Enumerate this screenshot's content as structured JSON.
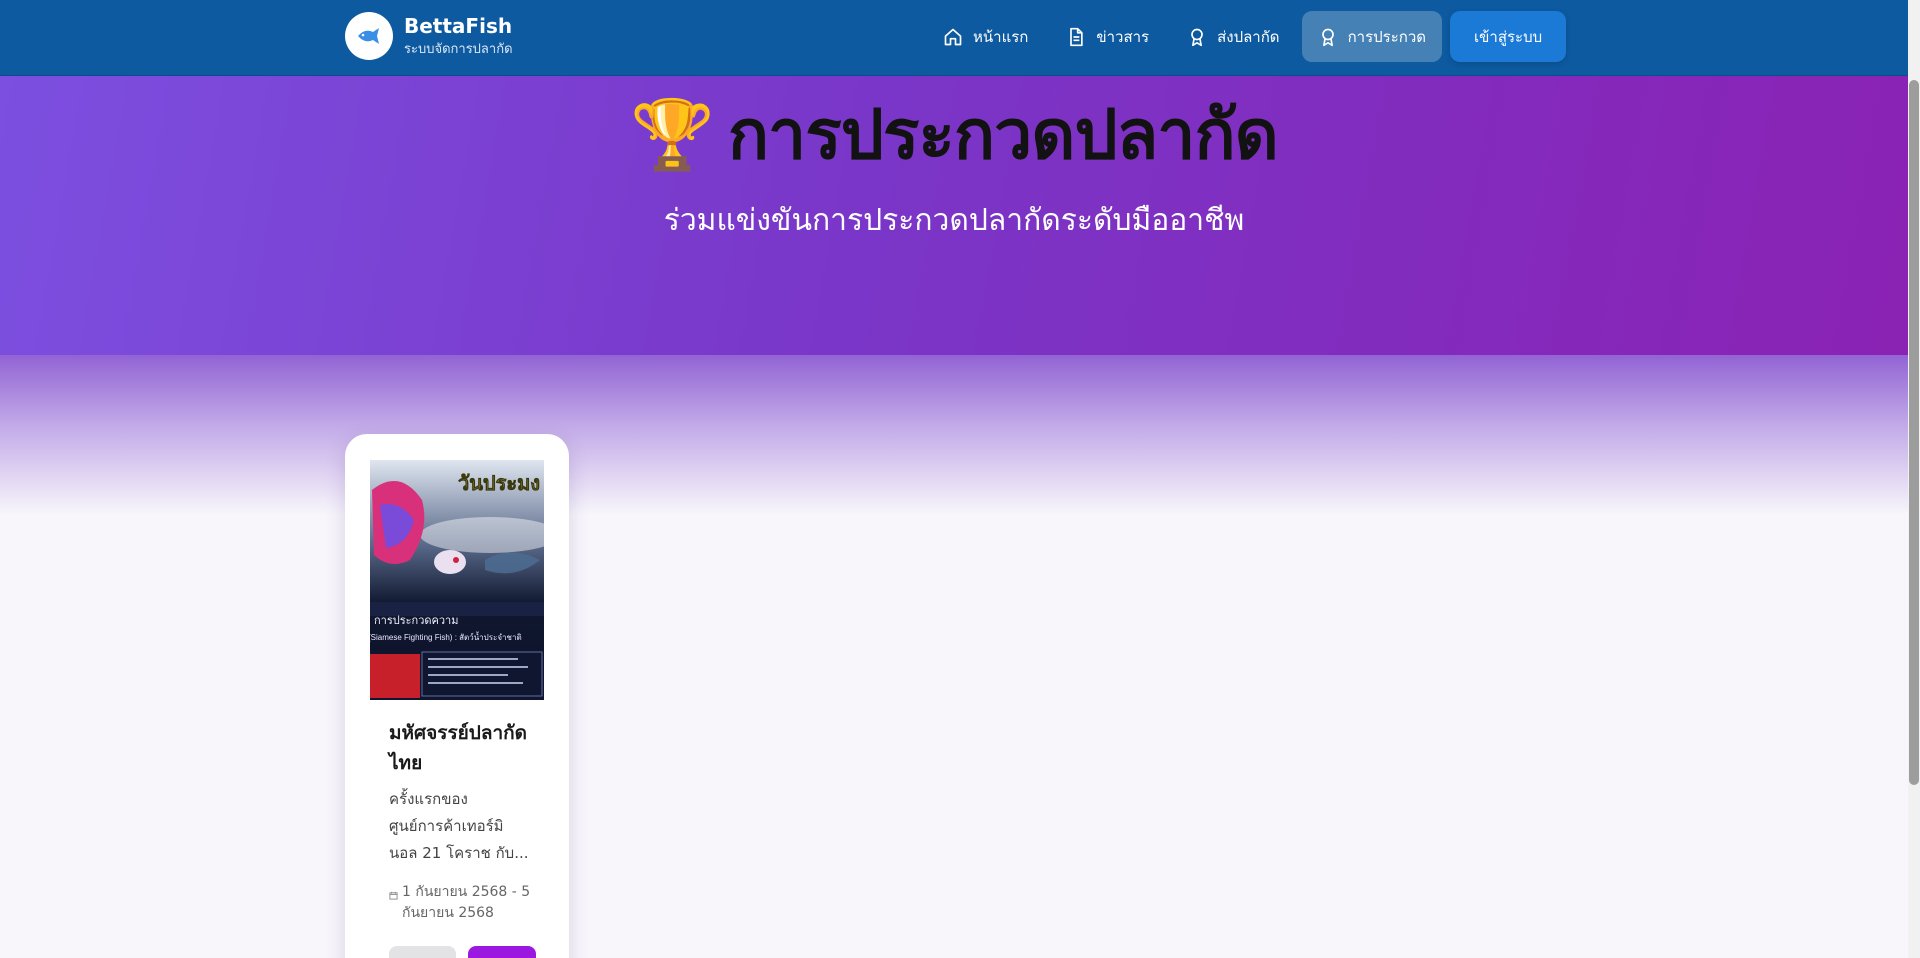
{
  "brand": {
    "title": "BettaFish",
    "subtitle": "ระบบจัดการปลากัด",
    "logo_icon": "fish-icon"
  },
  "nav": {
    "items": [
      {
        "label": "หน้าแรก",
        "icon": "home-icon",
        "active": false
      },
      {
        "label": "ข่าวสาร",
        "icon": "document-icon",
        "active": false
      },
      {
        "label": "ส่งปลากัด",
        "icon": "award-icon",
        "active": false
      },
      {
        "label": "การประกวด",
        "icon": "award-icon",
        "active": true
      }
    ],
    "login_label": "เข้าสู่ระบบ"
  },
  "hero": {
    "icon": "🏆",
    "title": "การประกวดปลากัด",
    "subtitle": "ร่วมแข่งขันการประกวดปลากัดระดับมืออาชีพ"
  },
  "contests": [
    {
      "title": "มหัศจรรย์ปลากัดไทย",
      "description": "ครั้งแรกของศูนย์การค้าเทอร์มินอล 21 โคราช กับ...",
      "date": "1 กันยายน 2568 - 5 กันยายน 2568",
      "poster_heading": "วันประมง",
      "poster_line1": "การประกวดความ",
      "poster_line2": "(Siamese Fighting Fish) : สัตว์น้ำประจำชาติ"
    }
  ],
  "colors": {
    "header": "#0d5aa0",
    "login_button": "#1a7ad6",
    "hero_start": "#7c4fe0",
    "hero_end": "#8a22b4",
    "join_button": "#9a18e0"
  }
}
